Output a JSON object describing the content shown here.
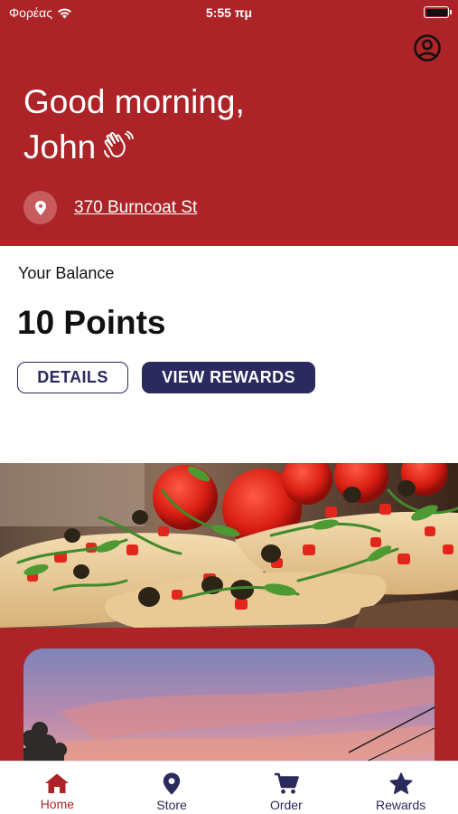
{
  "status_bar": {
    "carrier": "Φορέας",
    "time": "5:55 πμ"
  },
  "header": {
    "greeting_line1": "Good morning,",
    "greeting_name": "John",
    "address": "370 Burncoat St"
  },
  "balance": {
    "label": "Your Balance",
    "points": "10 Points",
    "details_label": "DETAILS",
    "view_rewards_label": "VIEW REWARDS"
  },
  "tabs": [
    {
      "label": "Home",
      "icon": "home-icon",
      "active": true
    },
    {
      "label": "Store",
      "icon": "location-pin-icon",
      "active": false
    },
    {
      "label": "Order",
      "icon": "cart-icon",
      "active": false
    },
    {
      "label": "Rewards",
      "icon": "star-icon",
      "active": false
    }
  ],
  "colors": {
    "brand_red": "#ac2427",
    "navy": "#2a2a5e"
  }
}
